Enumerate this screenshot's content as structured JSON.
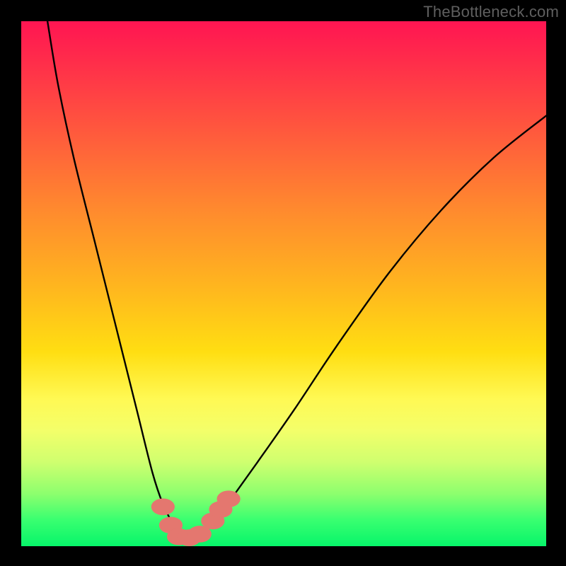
{
  "watermark": "TheBottleneck.com",
  "chart_data": {
    "type": "line",
    "title": "",
    "xlabel": "",
    "ylabel": "",
    "xlim": [
      0,
      100
    ],
    "ylim": [
      0,
      100
    ],
    "grid": false,
    "legend": false,
    "series": [
      {
        "name": "bottleneck-curve",
        "color": "#000000",
        "x": [
          5,
          7,
          10,
          14,
          18,
          22,
          25,
          27,
          29,
          30,
          31,
          33,
          35,
          37,
          40,
          45,
          52,
          60,
          70,
          80,
          90,
          100
        ],
        "y": [
          100,
          88,
          74,
          58,
          42,
          26,
          14,
          8,
          4,
          2,
          2,
          2,
          3,
          5,
          9,
          16,
          26,
          38,
          52,
          64,
          74,
          82
        ]
      }
    ],
    "markers": [
      {
        "name": "marker-1",
        "x": 27.0,
        "y": 7.5,
        "r": 1.6,
        "color": "#e4776f"
      },
      {
        "name": "marker-2",
        "x": 28.5,
        "y": 4.0,
        "r": 1.6,
        "color": "#e4776f"
      },
      {
        "name": "marker-3",
        "x": 30.0,
        "y": 1.8,
        "r": 1.6,
        "color": "#e4776f"
      },
      {
        "name": "marker-4",
        "x": 32.0,
        "y": 1.6,
        "r": 1.6,
        "color": "#e4776f"
      },
      {
        "name": "marker-5",
        "x": 34.0,
        "y": 2.3,
        "r": 1.6,
        "color": "#e4776f"
      },
      {
        "name": "marker-6",
        "x": 36.5,
        "y": 4.8,
        "r": 1.6,
        "color": "#e4776f"
      },
      {
        "name": "marker-7",
        "x": 38.0,
        "y": 7.0,
        "r": 1.6,
        "color": "#e4776f"
      },
      {
        "name": "marker-8",
        "x": 39.5,
        "y": 9.0,
        "r": 1.6,
        "color": "#e4776f"
      }
    ],
    "background_gradient": {
      "top": "#ff1552",
      "mid": "#ffde12",
      "bottom": "#07f56a"
    }
  }
}
